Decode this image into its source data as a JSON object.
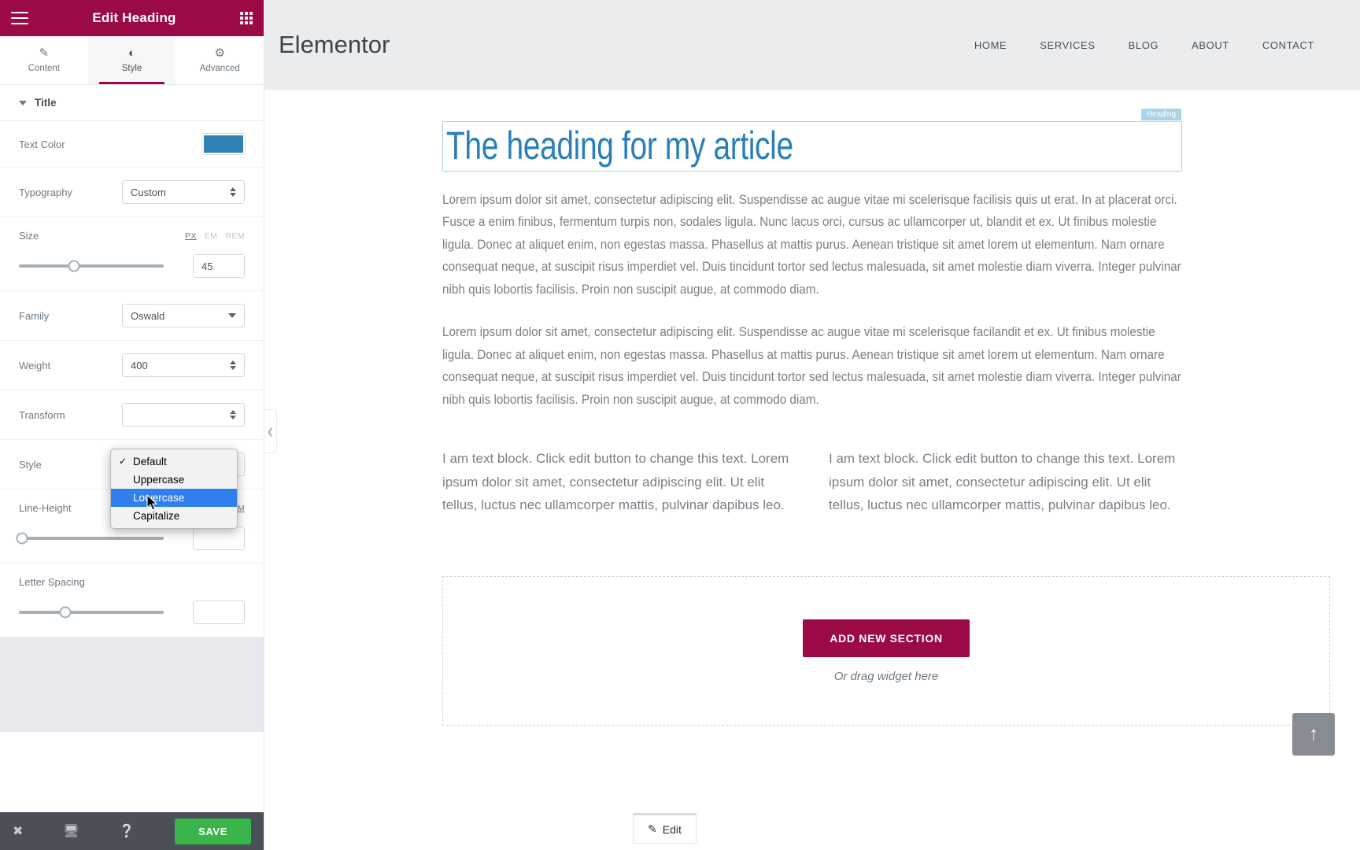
{
  "panel": {
    "header": {
      "title": "Edit Heading",
      "menu_icon": "hamburger-icon",
      "widgets_icon": "grid-icon"
    },
    "tabs": [
      {
        "label": "Content",
        "icon": "pencil-icon",
        "active": false
      },
      {
        "label": "Style",
        "icon": "contrast-icon",
        "active": true
      },
      {
        "label": "Advanced",
        "icon": "gear-icon",
        "active": false
      }
    ],
    "section": {
      "title": "Title"
    },
    "controls": {
      "text_color": {
        "label": "Text Color",
        "value": "#2d82b5"
      },
      "typography": {
        "label": "Typography",
        "value": "Custom"
      },
      "size": {
        "label": "Size",
        "value": "45",
        "units": [
          "PX",
          "EM",
          "REM"
        ],
        "active_unit": "PX"
      },
      "family": {
        "label": "Family",
        "value": "Oswald"
      },
      "weight": {
        "label": "Weight",
        "value": "400"
      },
      "transform": {
        "label": "Transform",
        "value": ""
      },
      "style": {
        "label": "Style",
        "value": ""
      },
      "line_height": {
        "label": "Line-Height",
        "value": "",
        "units": [
          "PX",
          "EM"
        ],
        "active_unit": "EM"
      },
      "letter_spacing": {
        "label": "Letter Spacing",
        "value": ""
      }
    },
    "transform_dropdown": {
      "options": [
        {
          "label": "Default",
          "checked": true,
          "selected": false
        },
        {
          "label": "Uppercase",
          "checked": false,
          "selected": false
        },
        {
          "label": "Lowercase",
          "checked": false,
          "selected": true
        },
        {
          "label": "Capitalize",
          "checked": false,
          "selected": false
        }
      ]
    },
    "footer": {
      "close_icon": "close-icon",
      "responsive_icon": "monitor-icon",
      "help_icon": "question-icon",
      "save_label": "SAVE",
      "save_color": "#39b54a"
    },
    "collapse_icon": "chevron-left-icon"
  },
  "preview": {
    "site": {
      "logo": "Elementor",
      "nav": [
        "HOME",
        "SERVICES",
        "BLOG",
        "ABOUT",
        "CONTACT"
      ]
    },
    "heading": {
      "text": "The heading for my article",
      "badge": "Heading",
      "color": "#2b7fb8"
    },
    "paragraphs": [
      "Lorem ipsum dolor sit amet, consectetur adipiscing elit. Suspendisse ac augue vitae mi scelerisque facilisis quis ut erat. In at placerat orci. Fusce a enim finibus, fermentum turpis non, sodales ligula. Nunc lacus orci, cursus ac ullamcorper ut, blandit et ex. Ut finibus molestie ligula. Donec at aliquet enim, non egestas massa. Phasellus at mattis purus. Aenean tristique sit amet lorem ut elementum. Nam ornare consequat neque, at suscipit risus imperdiet vel. Duis tincidunt tortor sed lectus malesuada, sit amet molestie diam viverra. Integer pulvinar nibh quis lobortis facilisis. Proin non suscipit augue, at commodo diam.",
      "Lorem ipsum dolor sit amet, consectetur adipiscing elit. Suspendisse ac augue vitae mi scelerisque facilandit et ex. Ut finibus molestie ligula. Donec at aliquet enim, non egestas massa. Phasellus at mattis purus. Aenean tristique sit amet lorem ut elementum. Nam ornare consequat neque, at suscipit risus imperdiet vel. Duis tincidunt tortor sed lectus malesuada, sit amet molestie diam viverra. Integer pulvinar nibh quis lobortis facilisis. Proin non suscipit augue, at commodo diam."
    ],
    "text_blocks": [
      "I am text block. Click edit button to change this text. Lorem ipsum dolor sit amet, consectetur adipiscing elit. Ut elit tellus, luctus nec ullamcorper mattis, pulvinar dapibus leo.",
      "I am text block. Click edit button to change this text. Lorem ipsum dolor sit amet, consectetur adipiscing elit. Ut elit tellus, luctus nec ullamcorper mattis, pulvinar dapibus leo."
    ],
    "dropzone": {
      "add_section_label": "ADD NEW SECTION",
      "drag_hint": "Or drag widget here",
      "button_color": "#9b0a46"
    },
    "edit_chip": {
      "label": "Edit",
      "icon": "pencil-icon"
    },
    "scroll_top": {
      "icon": "arrow-up-icon"
    }
  }
}
